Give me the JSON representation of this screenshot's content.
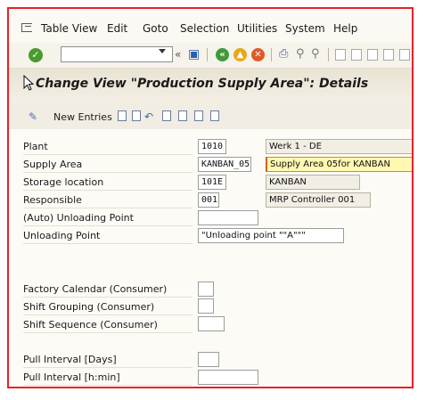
{
  "menu": {
    "items": [
      "Table View",
      "Edit",
      "Goto",
      "Selection",
      "Utilities",
      "System",
      "Help"
    ]
  },
  "toolbar": {
    "command_value": "",
    "icons": [
      "enter-icon",
      "save-icon",
      "back-icon",
      "exit-icon",
      "cancel-icon",
      "print-icon",
      "find-icon",
      "find-next-icon",
      "first-page-icon",
      "previous-page-icon",
      "next-page-icon",
      "last-page-icon"
    ]
  },
  "colors": {
    "frame_border": "#e8202a",
    "highlight_field": "#fff8b0",
    "enter_green": "#4a9a2e"
  },
  "header": {
    "title": "Change View \"Production Supply Area\": Details"
  },
  "app_toolbar": {
    "new_entries_label": "New Entries"
  },
  "form": {
    "plant": {
      "label": "Plant",
      "value": "1010",
      "description": "Werk 1 - DE"
    },
    "supply_area": {
      "label": "Supply Area",
      "value": "KANBAN_05",
      "description": "Supply Area 05for KANBAN"
    },
    "storage_location": {
      "label": "Storage location",
      "value": "101E",
      "description": "KANBAN"
    },
    "responsible": {
      "label": "Responsible",
      "value": "001",
      "description": "MRP Controller 001"
    },
    "auto_unloading_point": {
      "label": "(Auto) Unloading Point",
      "value": ""
    },
    "unloading_point": {
      "label": "Unloading Point",
      "value": "\"Unloading point \"\"A\"\"\""
    },
    "factory_calendar": {
      "label": "Factory Calendar (Consumer)",
      "value": ""
    },
    "shift_grouping": {
      "label": "Shift Grouping (Consumer)",
      "value": ""
    },
    "shift_sequence": {
      "label": "Shift Sequence (Consumer)",
      "value": ""
    },
    "pull_interval_days": {
      "label": "Pull Interval [Days]",
      "value": ""
    },
    "pull_interval_hmin": {
      "label": "Pull Interval [h:min]",
      "value": ""
    }
  }
}
